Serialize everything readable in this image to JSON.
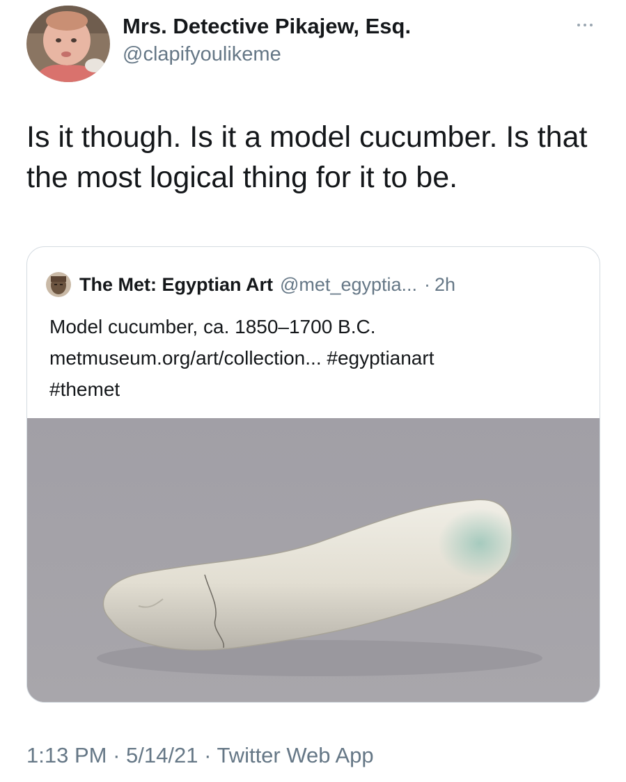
{
  "author": {
    "display_name": "Mrs. Detective Pikajew, Esq.",
    "handle": "@clapifyoulikeme"
  },
  "tweet": {
    "text": "Is it though. Is it a model cucumber. Is that the most logical thing for it to be."
  },
  "quoted_tweet": {
    "name": "The Met: Egyptian Art",
    "handle": "@met_egyptia...",
    "separator": "·",
    "time": "2h",
    "text_lines": [
      "Model cucumber, ca. 1850–1700 B.C.",
      "metmuseum.org/art/collection... #egyptianart",
      "#themet"
    ]
  },
  "meta": {
    "time": "1:13 PM",
    "sep1": " · ",
    "date": "5/14/21",
    "sep2": " · ",
    "source": "Twitter Web App"
  },
  "colors": {
    "text": "#14171a",
    "secondary": "#657786",
    "border": "#d4dbe1",
    "media_background": "#a4a2a8"
  },
  "icons": {
    "more": "more-horizontal-icon"
  }
}
